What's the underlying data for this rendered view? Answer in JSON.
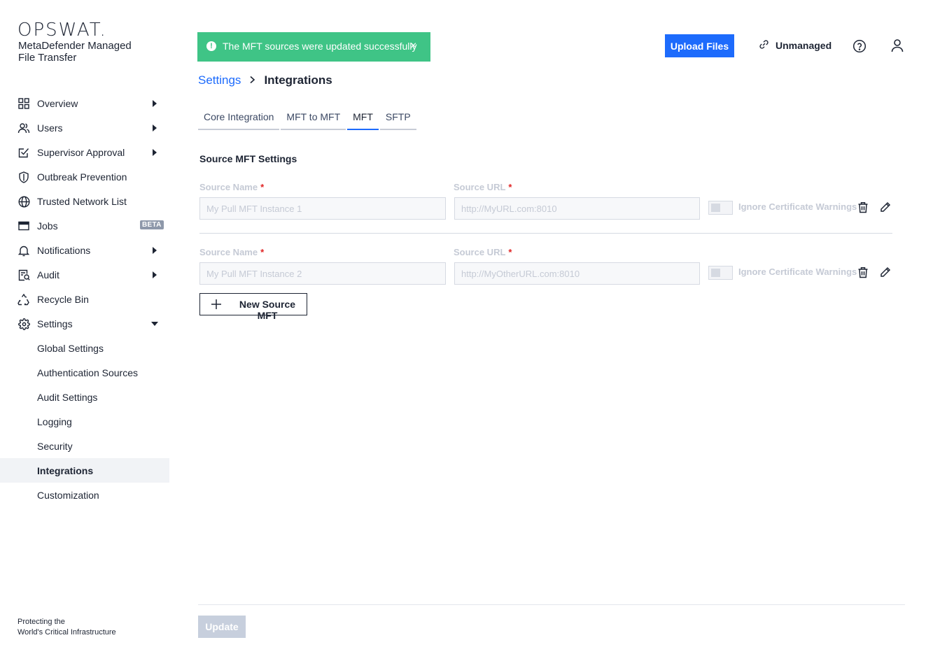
{
  "brand": {
    "logo": "OPSWAT.",
    "product": "MetaDefender Managed File Transfer",
    "tagline_line1": "Protecting the",
    "tagline_line2": "World's Critical Infrastructure"
  },
  "sidebar": {
    "items": [
      {
        "label": "Overview",
        "icon": "grid-icon"
      },
      {
        "label": "Users",
        "icon": "users-icon"
      },
      {
        "label": "Supervisor Approval",
        "icon": "approval-check-icon"
      },
      {
        "label": "Outbreak Prevention",
        "icon": "shield-icon"
      },
      {
        "label": "Trusted Network List",
        "icon": "globe-icon"
      },
      {
        "label": "Jobs",
        "icon": "window-icon",
        "badge": "BETA"
      },
      {
        "label": "Notifications",
        "icon": "bell-icon"
      },
      {
        "label": "Audit",
        "icon": "audit-icon"
      },
      {
        "label": "Recycle Bin",
        "icon": "recycle-icon"
      },
      {
        "label": "Settings",
        "icon": "gear-icon"
      }
    ],
    "settings_sub": [
      "Global Settings",
      "Authentication Sources",
      "Audit Settings",
      "Logging",
      "Security",
      "Integrations",
      "Customization"
    ],
    "active_sub": "Integrations"
  },
  "toast": {
    "message": "The MFT sources were updated successfully",
    "color": "#3fc486"
  },
  "header": {
    "upload_label": "Upload Files",
    "unmanaged_label": "Unmanaged",
    "accent": "#1d6bfc"
  },
  "breadcrumb": {
    "parent": "Settings",
    "current": "Integrations"
  },
  "tabs": [
    "Core Integration",
    "MFT to MFT",
    "MFT",
    "SFTP"
  ],
  "active_tab": "MFT",
  "section_title": "Source MFT Settings",
  "sources": [
    {
      "name_label": "Source Name",
      "name_value": "My Pull MFT Instance 1",
      "url_label": "Source URL",
      "url_value": "http://MyURL.com:8010",
      "toggle_label": "Ignore Certificate Warnings"
    },
    {
      "name_label": "Source Name",
      "name_value": "My Pull MFT Instance 2",
      "url_label": "Source URL",
      "url_value": "http://MyOtherURL.com:8010",
      "toggle_label": "Ignore Certificate Warnings"
    }
  ],
  "required_mark": "*",
  "new_source_label": "New Source MFT",
  "update_label": "Update"
}
